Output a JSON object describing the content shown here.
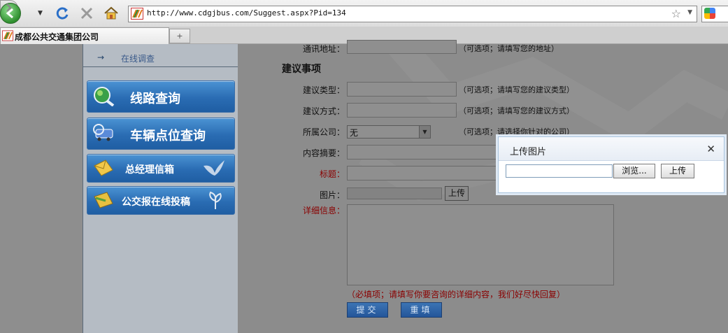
{
  "browser": {
    "url": "http://www.cdgjbus.com/Suggest.aspx?Pid=134",
    "tab_title": "成都公共交通集团公司",
    "new_tab": "+"
  },
  "sidebar": {
    "survey_arrow": "→",
    "survey_label": "在线调查",
    "buttons": [
      {
        "label": "线路查询"
      },
      {
        "label": "车辆点位查询"
      },
      {
        "label": "总经理信箱"
      },
      {
        "label": "公交报在线投稿"
      }
    ]
  },
  "form": {
    "partial_label": "通讯地址：",
    "partial_hint": "（可选项；请填写您的地址）",
    "section_title": "建议事项",
    "type_label": "建议类型：",
    "type_hint": "（可选项；请填写您的建议类型）",
    "method_label": "建议方式：",
    "method_hint": "（可选项；请填写您的建议方式）",
    "company_label": "所属公司：",
    "company_value": "无",
    "company_hint": "（可选项；请选择你针对的公司）",
    "summary_label": "内容摘要：",
    "subject_label": "标题：",
    "image_label": "图片：",
    "image_upload": "上传",
    "detail_label": "详细信息：",
    "detail_hint": "（必填项；请填写你要咨询的详细内容，我们好尽快回复）",
    "submit": "提交",
    "reset": "重填"
  },
  "dialog": {
    "title": "上传图片",
    "close": "✕",
    "browse": "浏览...",
    "upload": "上传"
  }
}
